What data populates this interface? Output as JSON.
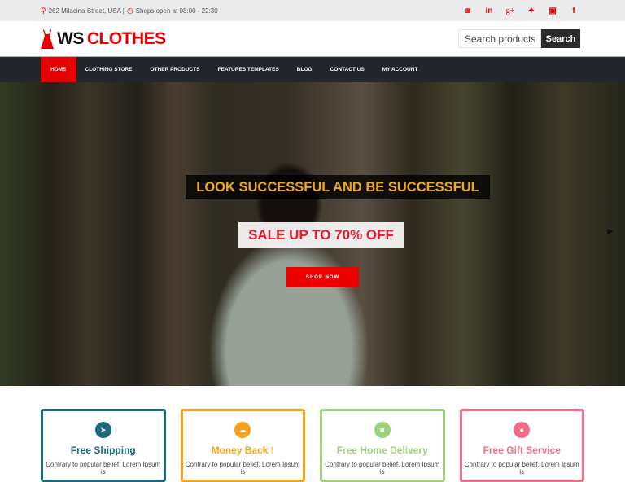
{
  "topbar": {
    "address": "262 Milacina Street, USA |",
    "hours": "Shops open at 08:00 - 22:30",
    "social": [
      {
        "icon": "instagram-icon",
        "glyph": "◙"
      },
      {
        "icon": "linkedin-icon",
        "glyph": "in"
      },
      {
        "icon": "google-plus-icon",
        "glyph": "g+"
      },
      {
        "icon": "twitter-icon",
        "glyph": "🐦"
      },
      {
        "icon": "youtube-icon",
        "glyph": "▣"
      },
      {
        "icon": "facebook-icon",
        "glyph": "f"
      }
    ]
  },
  "header": {
    "logo_ws": "WS",
    "logo_clothes": "CLOTHES",
    "search_placeholder": "Search products...",
    "search_button": "Search"
  },
  "nav": {
    "items": [
      "Home",
      "Clothing Store",
      "Other Products",
      "Features Templates",
      "Blog",
      "Contact Us",
      "My Account"
    ],
    "active": "Home"
  },
  "hero": {
    "headline": "LOOK SUCCESSFUL AND BE SUCCESSFUL",
    "sale": "SALE UP TO 70% OFF",
    "cta": "SHOP NOW"
  },
  "features": [
    {
      "title": "Free Shipping",
      "text": "Contrary to popular belief, Lorem Ipsum is",
      "color": "#1a6a80",
      "icon": "paper-plane-icon",
      "glyph": "➤"
    },
    {
      "title": "Money Back !",
      "text": "Contrary to popular belief, Lorem Ipsum is",
      "color": "#f5a31a",
      "icon": "money-icon",
      "glyph": "☁"
    },
    {
      "title": "Free Home Delivery",
      "text": "Contrary to popular belief, Lorem Ipsum is",
      "color": "#9fd07c",
      "icon": "truck-icon",
      "glyph": "■"
    },
    {
      "title": "Free Gift Service",
      "text": "Contrary to popular belief, Lorem Ipsum is",
      "color": "#f06d86",
      "icon": "gift-icon",
      "glyph": "●"
    }
  ]
}
